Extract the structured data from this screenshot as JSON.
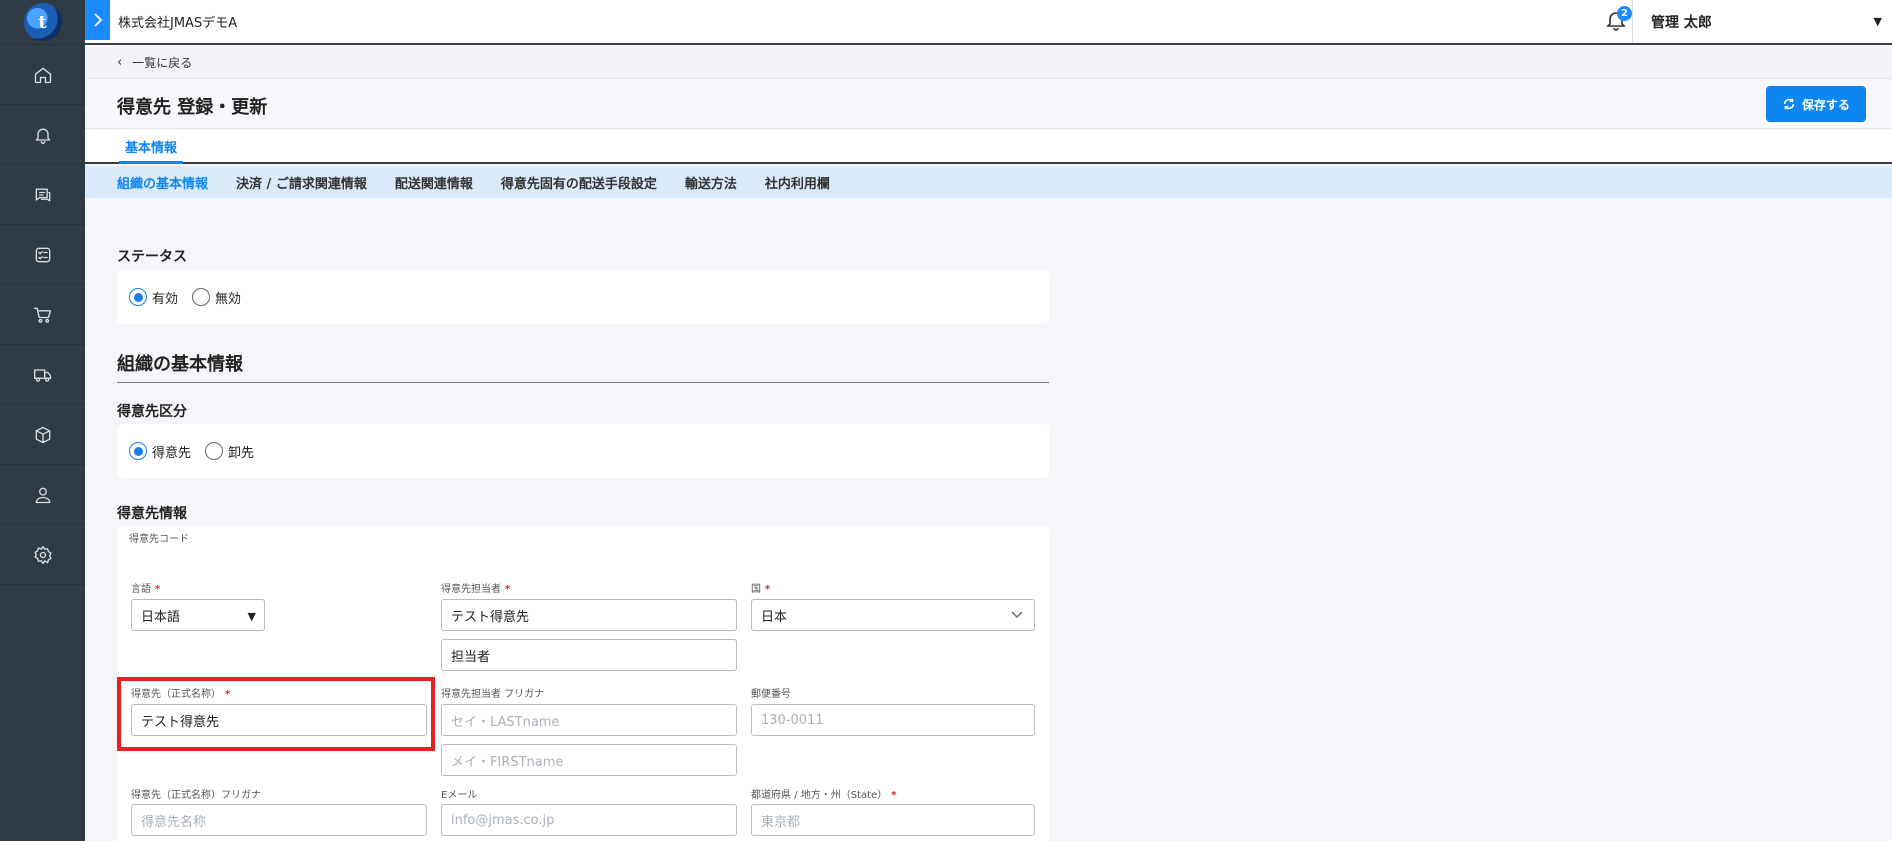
{
  "topbar": {
    "company": "株式会社JMASデモA",
    "notification_count": "2",
    "user_name": "管理 太郎"
  },
  "sidebar": {
    "logo_text": "t",
    "items": [
      "home-icon",
      "bell-icon",
      "chat-icon",
      "checklist-icon",
      "cart-icon",
      "truck-icon",
      "box-icon",
      "user-icon",
      "gear-icon"
    ]
  },
  "back": {
    "label": "一覧に戻る"
  },
  "page": {
    "title": "得意先 登録・更新",
    "save_label": "保存する"
  },
  "main_tabs": [
    "基本情報"
  ],
  "sub_tabs": [
    "組織の基本情報",
    "決済 / ご請求関連情報",
    "配送関連情報",
    "得意先固有の配送手段設定",
    "輸送方法",
    "社内利用欄"
  ],
  "status": {
    "label": "ステータス",
    "options": [
      "有効",
      "無効"
    ],
    "selected": "有効"
  },
  "org_section_title": "組織の基本情報",
  "customer_type": {
    "label": "得意先区分",
    "options": [
      "得意先",
      "卸先"
    ],
    "selected": "得意先"
  },
  "customer_info": {
    "label": "得意先情報",
    "code_label": "得意先コード",
    "language": {
      "label": "言語",
      "value": "日本語"
    },
    "contact": {
      "label": "得意先担当者",
      "value1": "テスト得意先",
      "value2": "担当者"
    },
    "country": {
      "label": "国",
      "value": "日本"
    },
    "official_name": {
      "label": "得意先（正式名称）",
      "value": "テスト得意先"
    },
    "contact_kana": {
      "label": "得意先担当者 フリガナ",
      "placeholder1": "セイ・LASTname",
      "placeholder2": "メイ・FIRSTname"
    },
    "postal": {
      "label": "郵便番号",
      "placeholder": "130-0011"
    },
    "official_kana": {
      "label": "得意先（正式名称）フリガナ",
      "placeholder": "得意先名称"
    },
    "email": {
      "label": "Eメール",
      "placeholder": "info@jmas.co.jp"
    },
    "prefecture": {
      "label": "都道府県 / 地方・州（State）",
      "placeholder": "東京都"
    }
  },
  "colors": {
    "accent": "#0d86f2",
    "sidebar": "#2f3b45",
    "highlight": "#e52222"
  }
}
